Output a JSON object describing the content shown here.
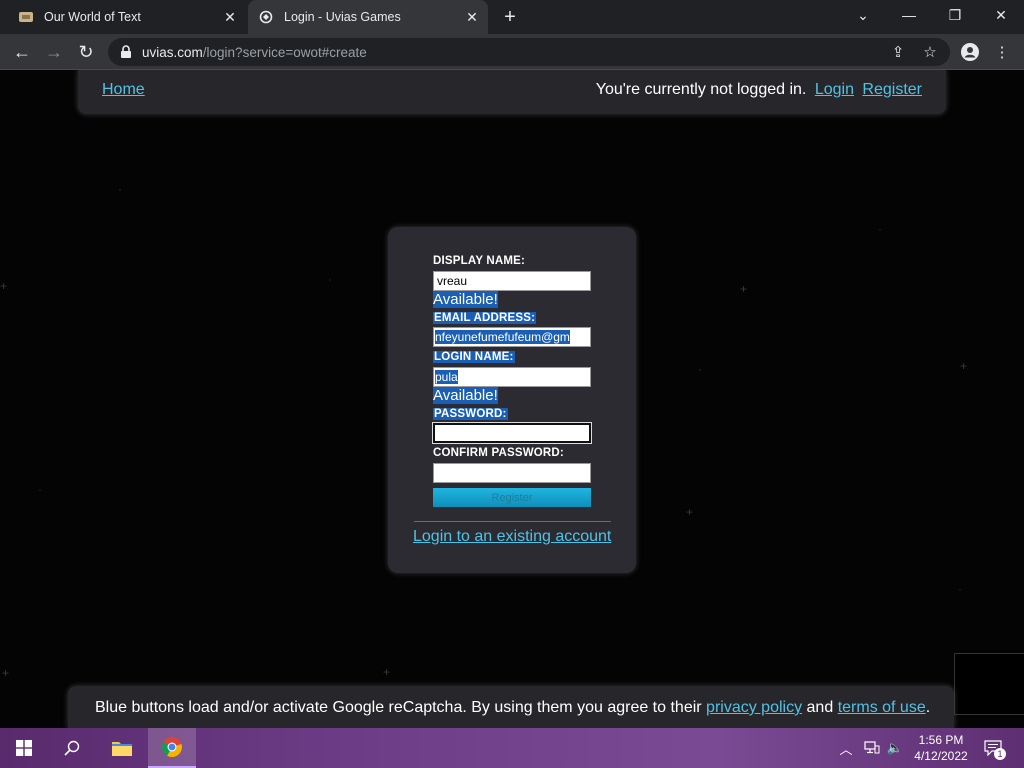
{
  "browser": {
    "tabs": [
      {
        "title": "Our World of Text",
        "active": false
      },
      {
        "title": "Login - Uvias Games",
        "active": true
      }
    ],
    "address": {
      "host": "uvias.com",
      "path": "/login?service=owot#create"
    }
  },
  "nav": {
    "home": "Home",
    "status_text": "You're currently not logged in.",
    "login": "Login",
    "register": "Register"
  },
  "form": {
    "display_name_label": "DISPLAY NAME:",
    "display_name_value": "vreau",
    "display_name_status": "Available!",
    "email_label": "EMAIL ADDRESS:",
    "email_value": "nfeyunefumefufeum@gm",
    "login_name_label": "LOGIN NAME:",
    "login_name_value": "pula",
    "login_name_status": "Available!",
    "password_label": "PASSWORD:",
    "confirm_password_label": "CONFIRM PASSWORD:",
    "register_button": "Register",
    "existing_account_link": "Login to an existing account"
  },
  "footer": {
    "text_before": "Blue buttons load and/or activate Google reCaptcha. By using them you agree to their",
    "privacy_policy": "privacy policy",
    "and": "and",
    "terms_of_use": "terms of use",
    "period": "."
  },
  "taskbar": {
    "time": "1:56 PM",
    "date": "4/12/2022",
    "notification_count": "1"
  },
  "colors": {
    "link": "#4fc3e6",
    "card_bg": "#2c2b31",
    "selection": "#1a5fb4"
  }
}
